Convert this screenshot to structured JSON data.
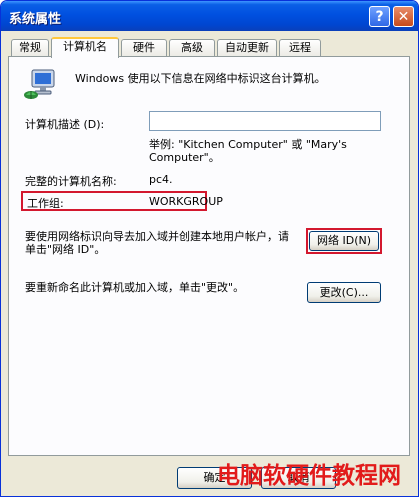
{
  "window": {
    "title": "系统属性",
    "help_glyph": "?",
    "close_glyph": "✕"
  },
  "tabs": [
    {
      "label": "常规",
      "active": false
    },
    {
      "label": "计算机名",
      "active": true
    },
    {
      "label": "硬件",
      "active": false
    },
    {
      "label": "高级",
      "active": false
    },
    {
      "label": "自动更新",
      "active": false
    },
    {
      "label": "远程",
      "active": false
    }
  ],
  "panel": {
    "intro": "Windows 使用以下信息在网络中标识这台计算机。",
    "description_label": "计算机描述 (D):",
    "description_value": "",
    "example_text": "举例: \"Kitchen Computer\" 或 \"Mary's Computer\"。",
    "full_name_label": "完整的计算机名称:",
    "full_name_value": "pc4.",
    "workgroup_label": "工作组:",
    "workgroup_value": "WORKGROUP",
    "network_id_text": "要使用网络标识向导去加入域并创建本地用户帐户，请单击\"网络 ID\"。",
    "network_id_button": "网络 ID(N)",
    "rename_text": "要重新命名此计算机或加入域，单击\"更改\"。",
    "change_button": "更改(C)..."
  },
  "footer": {
    "ok_button": "确定",
    "cancel_button": "取消"
  },
  "watermark": "电脑软硬件教程网",
  "icons": {
    "computer": "computer-network-icon"
  },
  "colors": {
    "highlight_border": "#d3182e",
    "watermark": "#e21b1b",
    "titlebar": "#0050e0"
  }
}
